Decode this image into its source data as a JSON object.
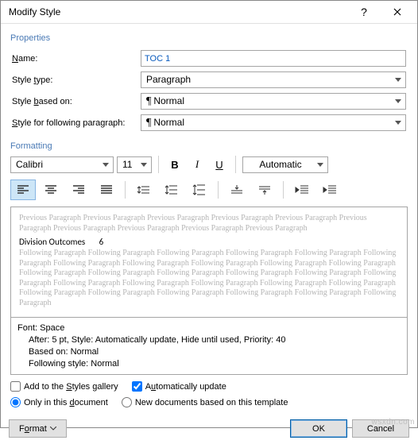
{
  "title": "Modify Style",
  "properties_label": "Properties",
  "fields": {
    "name_label": "Name:",
    "name_value": "TOC 1",
    "type_label": "Style type:",
    "type_value": "Paragraph",
    "based_label": "Style based on:",
    "based_value": "Normal",
    "following_label": "Style for following paragraph:",
    "following_value": "Normal"
  },
  "formatting_label": "Formatting",
  "formatting": {
    "font": "Calibri",
    "size": "11",
    "color": "Automatic"
  },
  "preview": {
    "prev_text": "Previous Paragraph Previous Paragraph Previous Paragraph Previous Paragraph Previous Paragraph Previous Paragraph Previous Paragraph Previous Paragraph Previous Paragraph Previous Paragraph",
    "sample_label": "Division Outcomes",
    "sample_value": "6",
    "next_text": "Following Paragraph Following Paragraph Following Paragraph Following Paragraph Following Paragraph Following Paragraph Following Paragraph Following Paragraph Following Paragraph Following Paragraph Following Paragraph Following Paragraph Following Paragraph Following Paragraph Following Paragraph Following Paragraph Following Paragraph Following Paragraph Following Paragraph Following Paragraph Following Paragraph Following Paragraph Following Paragraph Following Paragraph Following Paragraph Following Paragraph Following Paragraph Following Paragraph"
  },
  "description": {
    "line1": "Font: Space",
    "line2": "After: 5 pt, Style: Automatically update, Hide until used, Priority: 40",
    "line3": "Based on: Normal",
    "line4": "Following style: Normal"
  },
  "checks": {
    "gallery": "Add to the Styles gallery",
    "auto": "Automatically update",
    "doc_only": "Only in this document",
    "template": "New documents based on this template"
  },
  "buttons": {
    "format": "Format",
    "ok": "OK",
    "cancel": "Cancel"
  },
  "watermark": "wsxdn.com"
}
